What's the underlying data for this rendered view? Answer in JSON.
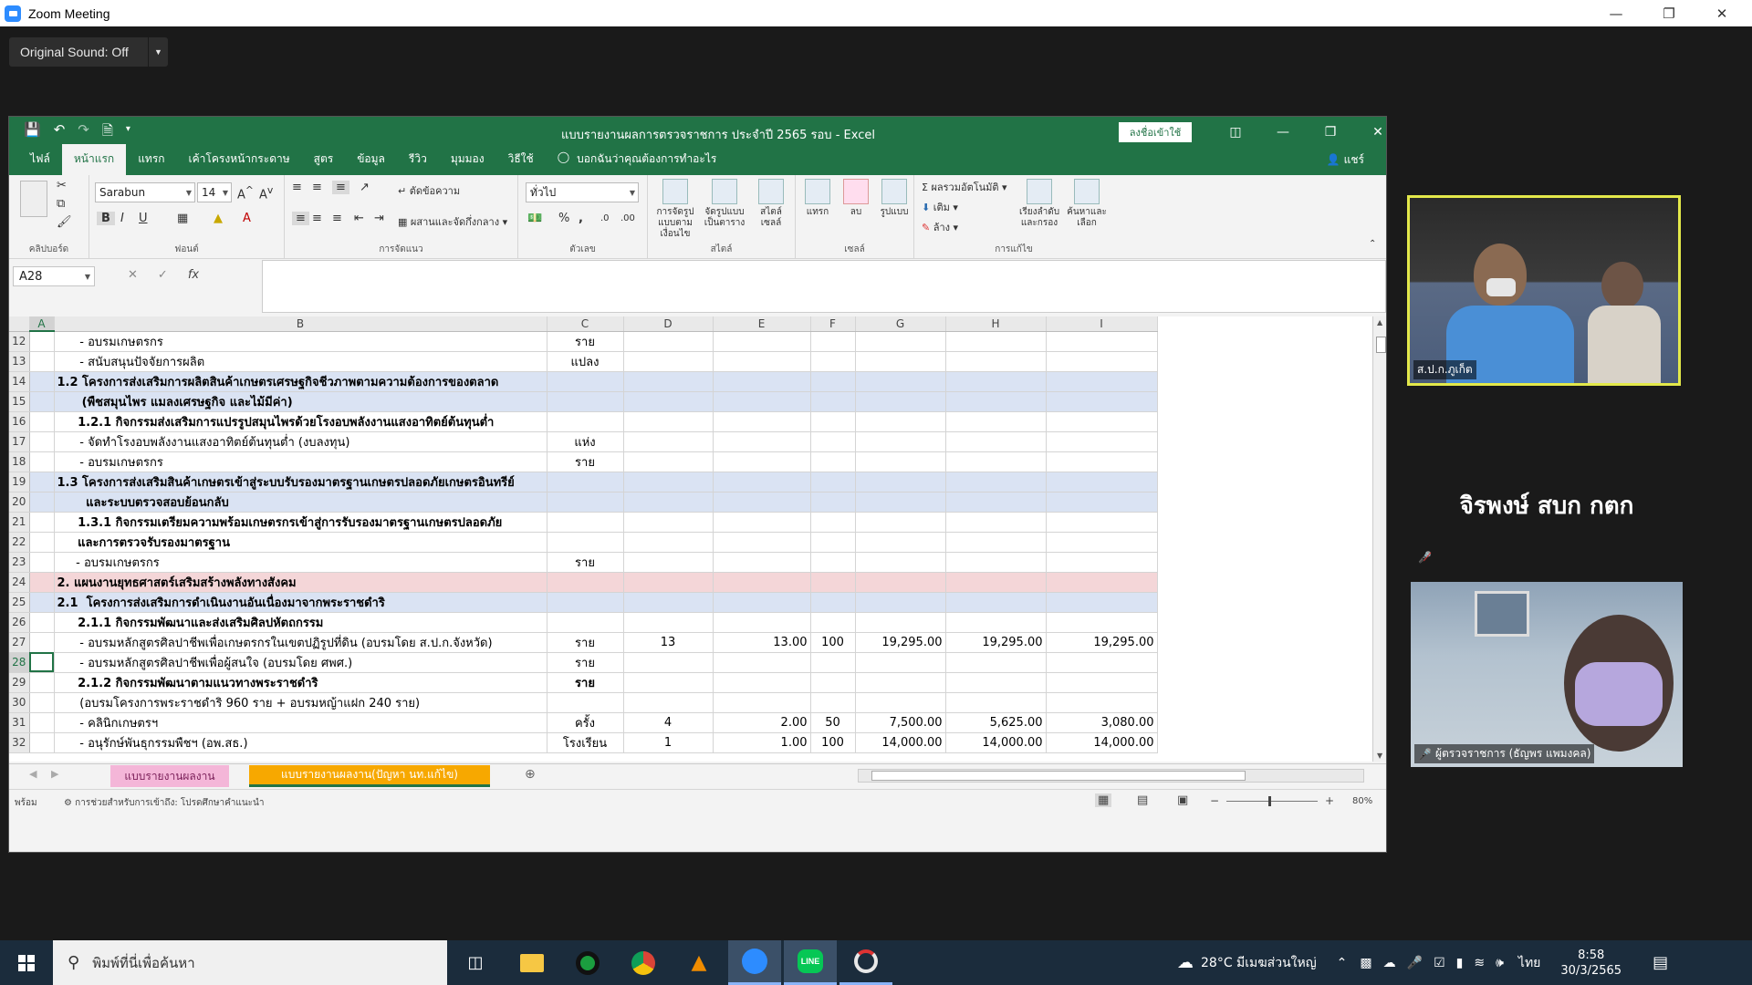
{
  "window": {
    "title": "Zoom Meeting"
  },
  "zoom": {
    "original_sound": "Original Sound: Off"
  },
  "excel": {
    "doc_title": "แบบรายงานผลการตรวจราชการ ประจำปี 2565 รอบ  -  Excel",
    "signin": "ลงชื่อเข้าใช้",
    "tabs": [
      "ไฟล์",
      "หน้าแรก",
      "แทรก",
      "เค้าโครงหน้ากระดาษ",
      "สูตร",
      "ข้อมูล",
      "รีวิว",
      "มุมมอง",
      "วิธีใช้"
    ],
    "tell_me": "บอกฉันว่าคุณต้องการทำอะไร",
    "share": "แชร์",
    "ribbon": {
      "font_name": "Sarabun",
      "font_size": "14",
      "wrap_text": "ตัดข้อความ",
      "merge_center": "ผสานและจัดกึ่งกลาง",
      "number_format": "ทั่วไป",
      "cond_format": "การจัดรูปแบบตามเงื่อนไข",
      "format_table": "จัดรูปแบบเป็นตาราง",
      "cell_styles": "สไตล์เซลล์",
      "insert": "แทรก",
      "delete": "ลบ",
      "format": "รูปแบบ",
      "autosum": "ผลรวมอัตโนมัติ",
      "fill": "เติม",
      "clear": "ล้าง",
      "sort_filter": "เรียงลำดับและกรอง",
      "find_select": "ค้นหาและเลือก",
      "groups": {
        "clipboard": "คลิปบอร์ด",
        "font": "ฟอนต์",
        "alignment": "การจัดแนว",
        "number": "ตัวเลข",
        "styles": "สไตล์",
        "cells": "เซลล์",
        "editing": "การแก้ไข"
      }
    },
    "name_box": "A28",
    "columns": [
      "A",
      "B",
      "C",
      "D",
      "E",
      "F",
      "G",
      "H",
      "I"
    ],
    "rows": [
      {
        "n": "12",
        "style": "",
        "b": "      - อบรมเกษตรกร",
        "bb": false,
        "c": "ราย",
        "d": "",
        "e": "",
        "f": "",
        "g": "",
        "h": "",
        "i": ""
      },
      {
        "n": "13",
        "style": "",
        "b": "      - สนับสนุนปัจจัยการผลิต",
        "bb": false,
        "c": "แปลง",
        "d": "",
        "e": "",
        "f": "",
        "g": "",
        "h": "",
        "i": ""
      },
      {
        "n": "14",
        "style": "blue",
        "b": "1.2 โครงการส่งเสริมการผลิตสินค้าเกษตรเศรษฐกิจชีวภาพตามความต้องการของตลาด",
        "bb": true,
        "c": "",
        "d": "",
        "e": "",
        "f": "",
        "g": "",
        "h": "",
        "i": ""
      },
      {
        "n": "15",
        "style": "blue",
        "b": "      (พืชสมุนไพร แมลงเศรษฐกิจ และไม้มีค่า)",
        "bb": true,
        "c": "",
        "d": "",
        "e": "",
        "f": "",
        "g": "",
        "h": "",
        "i": ""
      },
      {
        "n": "16",
        "style": "",
        "b": "     1.2.1 กิจกรรมส่งเสริมการแปรรูปสมุนไพรด้วยโรงอบพลังงานแสงอาทิตย์ต้นทุนต่ำ",
        "bb": true,
        "c": "",
        "d": "",
        "e": "",
        "f": "",
        "g": "",
        "h": "",
        "i": ""
      },
      {
        "n": "17",
        "style": "",
        "b": "      - จัดทำโรงอบพลังงานแสงอาทิตย์ต้นทุนต่ำ (งบลงทุน)",
        "bb": false,
        "c": "แห่ง",
        "d": "",
        "e": "",
        "f": "",
        "g": "",
        "h": "",
        "i": ""
      },
      {
        "n": "18",
        "style": "",
        "b": "      - อบรมเกษตรกร",
        "bb": false,
        "c": "ราย",
        "d": "",
        "e": "",
        "f": "",
        "g": "",
        "h": "",
        "i": ""
      },
      {
        "n": "19",
        "style": "blue",
        "b": "1.3 โครงการส่งเสริมสินค้าเกษตรเข้าสู่ระบบรับรองมาตรฐานเกษตรปลอดภัยเกษตรอินทรีย์",
        "bb": true,
        "c": "",
        "d": "",
        "e": "",
        "f": "",
        "g": "",
        "h": "",
        "i": ""
      },
      {
        "n": "20",
        "style": "blue",
        "b": "       และระบบตรวจสอบย้อนกลับ",
        "bb": true,
        "c": "",
        "d": "",
        "e": "",
        "f": "",
        "g": "",
        "h": "",
        "i": ""
      },
      {
        "n": "21",
        "style": "",
        "b": "     1.3.1 กิจกรรมเตรียมความพร้อมเกษตรกรเข้าสู่การรับรองมาตรฐานเกษตรปลอดภัย",
        "bb": true,
        "c": "",
        "d": "",
        "e": "",
        "f": "",
        "g": "",
        "h": "",
        "i": ""
      },
      {
        "n": "22",
        "style": "",
        "b": "     และการตรวจรับรองมาตรฐาน",
        "bb": true,
        "c": "",
        "d": "",
        "e": "",
        "f": "",
        "g": "",
        "h": "",
        "i": ""
      },
      {
        "n": "23",
        "style": "",
        "b": "     - อบรมเกษตรกร",
        "bb": false,
        "c": "ราย",
        "d": "",
        "e": "",
        "f": "",
        "g": "",
        "h": "",
        "i": ""
      },
      {
        "n": "24",
        "style": "pink",
        "b": "2. แผนงานยุทธศาสตร์เสริมสร้างพลังทางสังคม",
        "bb": true,
        "c": "",
        "d": "",
        "e": "",
        "f": "",
        "g": "",
        "h": "",
        "i": ""
      },
      {
        "n": "25",
        "style": "blue",
        "b": "2.1  โครงการส่งเสริมการดำเนินงานอันเนื่องมาจากพระราชดำริ",
        "bb": true,
        "c": "",
        "d": "",
        "e": "",
        "f": "",
        "g": "",
        "h": "",
        "i": ""
      },
      {
        "n": "26",
        "style": "",
        "b": "     2.1.1 กิจกรรมพัฒนาและส่งเสริมศิลปหัตถกรรม",
        "bb": true,
        "c": "",
        "d": "",
        "e": "",
        "f": "",
        "g": "",
        "h": "",
        "i": ""
      },
      {
        "n": "27",
        "style": "",
        "b": "      - อบรมหลักสูตรศิลปาชีพเพื่อเกษตรกรในเขตปฏิรูปที่ดิน (อบรมโดย ส.ป.ก.จังหวัด)",
        "bb": false,
        "c": "ราย",
        "d": "13",
        "e": "13.00",
        "f": "100",
        "g": "19,295.00",
        "h": "19,295.00",
        "i": "19,295.00"
      },
      {
        "n": "28",
        "style": "",
        "b": "      - อบรมหลักสูตรศิลปาชีพเพื่อผู้สนใจ (อบรมโดย ศพศ.)",
        "bb": false,
        "c": "ราย",
        "d": "",
        "e": "",
        "f": "",
        "g": "",
        "h": "",
        "i": ""
      },
      {
        "n": "29",
        "style": "",
        "b": "     2.1.2 กิจกรรมพัฒนาตามแนวทางพระราชดำริ",
        "bb": true,
        "c": "ราย",
        "d": "",
        "e": "",
        "f": "",
        "g": "",
        "h": "",
        "i": ""
      },
      {
        "n": "30",
        "style": "",
        "b": "      (อบรมโครงการพระราชดำริ 960 ราย + อบรมหญ้าแฝก 240 ราย)",
        "bb": false,
        "c": "",
        "d": "",
        "e": "",
        "f": "",
        "g": "",
        "h": "",
        "i": ""
      },
      {
        "n": "31",
        "style": "",
        "b": "      - คลินิกเกษตรฯ",
        "bb": false,
        "c": "ครั้ง",
        "d": "4",
        "e": "2.00",
        "f": "50",
        "g": "7,500.00",
        "h": "5,625.00",
        "i": "3,080.00"
      },
      {
        "n": "32",
        "style": "",
        "b": "      - อนุรักษ์พันธุกรรมพืชฯ (อพ.สธ.)",
        "bb": false,
        "c": "โรงเรียน",
        "d": "1",
        "e": "1.00",
        "f": "100",
        "g": "14,000.00",
        "h": "14,000.00",
        "i": "14,000.00"
      }
    ],
    "sheet_tabs": [
      "แบบรายงานผลงาน",
      "แบบรายงานผลงาน(ปัญหา นท.แก้ไข)"
    ],
    "status": {
      "ready": "พร้อม",
      "accessibility": "การช่วยสำหรับการเข้าถึง: โปรดศึกษาคำแนะนำ",
      "zoom": "80%"
    }
  },
  "participants": [
    {
      "name": "ส.ป.ก.ภูเก็ต"
    },
    {
      "name": "จิรพงษ์ สบก กตก"
    },
    {
      "name": "ผู้ตรวจราชการ (ธัญพร แพมงคล)"
    }
  ],
  "taskbar": {
    "search_placeholder": "พิมพ์ที่นี่เพื่อค้นหา",
    "weather": "28°C  มีเมฆส่วนใหญ่",
    "lang": "ไทย",
    "time": "8:58",
    "date": "30/3/2565"
  },
  "colors": {
    "excel_green": "#217346",
    "active_speaker": "#e3e84a",
    "taskbar": "#1b2c3c"
  }
}
